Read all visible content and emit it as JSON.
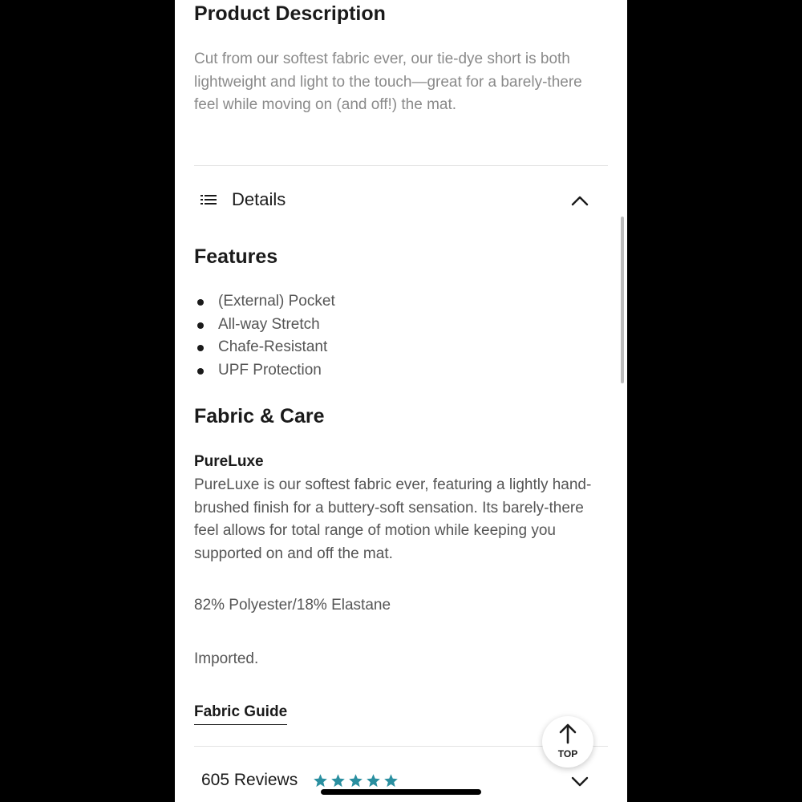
{
  "description": {
    "title": "Product Description",
    "text": "Cut from our softest fabric ever, our tie-dye short is both lightweight and light to the touch—great for a barely-there feel while moving on (and off!) the mat."
  },
  "details": {
    "label": "Details",
    "icon": "list-icon",
    "state": "expanded"
  },
  "features": {
    "title": "Features",
    "items": [
      "(External) Pocket",
      "All-way Stretch",
      "Chafe-Resistant",
      "UPF Protection"
    ]
  },
  "fabric_care": {
    "title": "Fabric & Care",
    "fabric_name": "PureLuxe",
    "fabric_description": "PureLuxe is our softest fabric ever, featuring a lightly hand-brushed finish for a buttery-soft sensation. Its barely-there feel allows for total range of motion while keeping you supported on and off the mat.",
    "composition": "82% Polyester/18% Elastane",
    "origin": "Imported.",
    "guide_link": "Fabric Guide"
  },
  "reviews": {
    "count_label": "605 Reviews",
    "rating": 5,
    "star_color": "#2a8fa0"
  },
  "top_button": {
    "label": "TOP",
    "icon": "arrow-up-icon"
  }
}
